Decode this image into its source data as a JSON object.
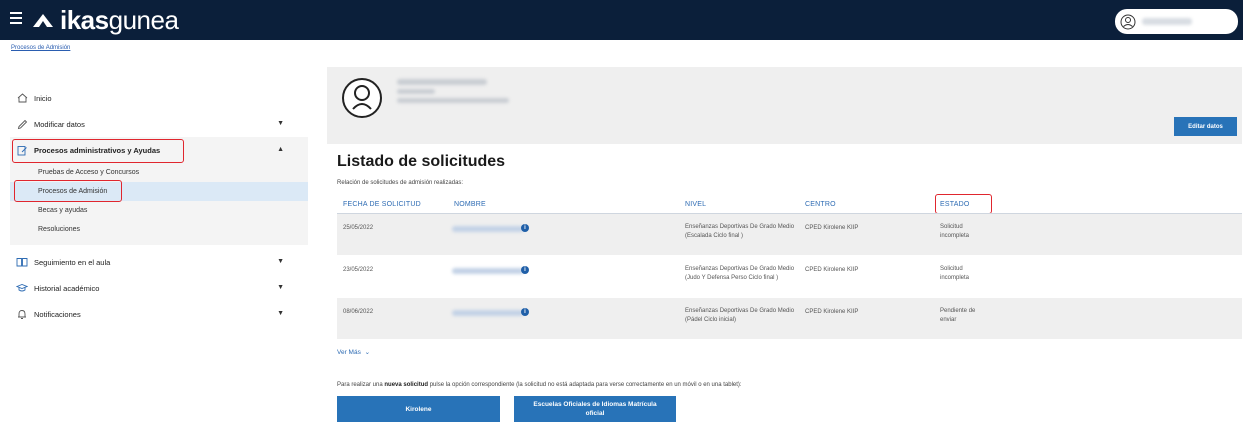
{
  "header": {
    "logo_bold": "ikas",
    "logo_light": "gunea"
  },
  "breadcrumb": "Procesos de Admisión",
  "sidebar": {
    "items": [
      {
        "label": "Inicio",
        "icon": "home-icon"
      },
      {
        "label": "Modificar datos",
        "icon": "pencil-icon",
        "arrow": "▼"
      },
      {
        "label": "Procesos administrativos y Ayudas",
        "icon": "form-icon",
        "arrow": "▲",
        "subitems": [
          {
            "label": "Pruebas de Acceso y Concursos"
          },
          {
            "label": "Procesos de Admisión"
          },
          {
            "label": "Becas y ayudas"
          },
          {
            "label": "Resoluciones"
          }
        ]
      },
      {
        "label": "Seguimiento en el aula",
        "icon": "book-icon",
        "arrow": "▼"
      },
      {
        "label": "Historial académico",
        "icon": "graduation-icon",
        "arrow": "▼"
      },
      {
        "label": "Notificaciones",
        "icon": "bell-icon",
        "arrow": "▼"
      }
    ]
  },
  "profile": {
    "edit_label": "Editar datos"
  },
  "main": {
    "title": "Listado de solicitudes",
    "subtitle": "Relación de solicitudes de admisión realizadas:",
    "columns": [
      "FECHA DE SOLICITUD",
      "NOMBRE",
      "NIVEL",
      "CENTRO",
      "ESTADO"
    ],
    "rows": [
      {
        "fecha": "25/05/2022",
        "nivel": "Enseñanzas Deportivas De Grado Medio (Escalada Ciclo final )",
        "centro": "CPED Kirolene KIIP",
        "estado": "Solicitud incompleta"
      },
      {
        "fecha": "23/05/2022",
        "nivel": "Enseñanzas Deportivas De Grado Medio (Judo Y Defensa Perso Ciclo final )",
        "centro": "CPED Kirolene KIIP",
        "estado": "Solicitud incompleta"
      },
      {
        "fecha": "08/06/2022",
        "nivel": "Enseñanzas Deportivas De Grado Medio (Pádel Ciclo inicial)",
        "centro": "CPED Kirolene KIIP",
        "estado": "Pendiente de enviar"
      }
    ],
    "ver_mas": "Ver Más",
    "note_before": "Para realizar una ",
    "note_bold": "nueva solicitud",
    "note_after": " pulse la opción correspondiente (la solicitud no está adaptada para verse correctamente en un móvil o en una tablet):",
    "buttons": [
      "Kirolene",
      "Escuelas Oficiales de Idiomas Matrícula oficial"
    ]
  },
  "colors": {
    "topbar": "#0b1f3a",
    "accent": "#2873b8",
    "highlight": "#e0262e"
  }
}
